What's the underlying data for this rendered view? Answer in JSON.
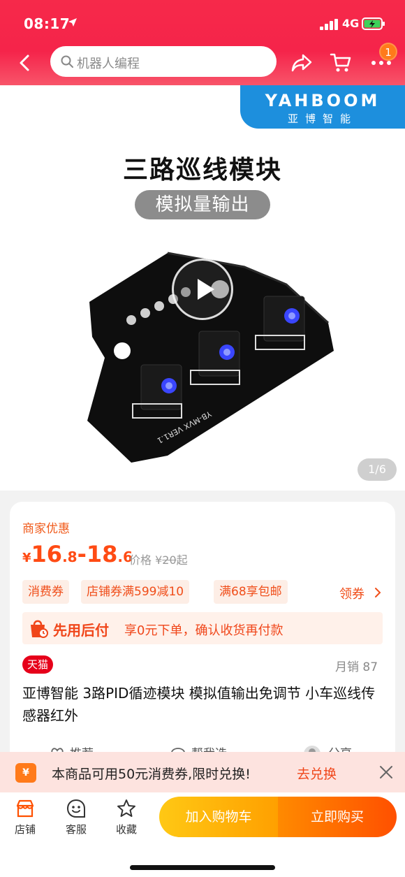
{
  "status_bar": {
    "time": "08:17",
    "network": "4G"
  },
  "header": {
    "search_placeholder": "机器人编程",
    "cart_badge": "1"
  },
  "gallery": {
    "brand_logo": "YAHBOOM",
    "brand_sub": "亚博智能",
    "title": "三路巡线模块",
    "subtitle": "模拟量输出",
    "board_label": "YB-MVX VER1.1",
    "page_counter": "1/6"
  },
  "card": {
    "merchant_label": "商家优惠",
    "price": {
      "currency": "¥",
      "low_int": "16",
      "low_dec": ".8",
      "dash": "-",
      "high_int": "18",
      "high_dec": ".6"
    },
    "ref_price": {
      "label": "价格",
      "currency": "¥",
      "value": "20",
      "suffix": "起"
    },
    "tags": [
      "消费券",
      "店铺券满599减10",
      "满68享包邮"
    ],
    "coupon_link": "领券",
    "paylater": {
      "title": "先用后付",
      "desc": "享0元下单，确认收货再付款"
    },
    "tmall_badge": "天猫",
    "monthly_sales": "月销 87",
    "product_name": "亚博智能 3路PID循迹模块 模拟值输出免调节 小车巡线传感器红外",
    "actions": [
      "推荐",
      "帮我选",
      "分享"
    ]
  },
  "promo": {
    "icon_text": "¥",
    "text": "本商品可用50元消费券,限时兑换!",
    "link": "去兑换"
  },
  "bottom_bar": {
    "shop": "店铺",
    "service": "客服",
    "favorite": "收藏",
    "add_cart": "加入购物车",
    "buy_now": "立即购买"
  },
  "colors": {
    "header_red": "#f5244a",
    "accent_orange": "#ff5000",
    "price_red": "#ff4b14",
    "brand_blue": "#1d8fdd"
  }
}
